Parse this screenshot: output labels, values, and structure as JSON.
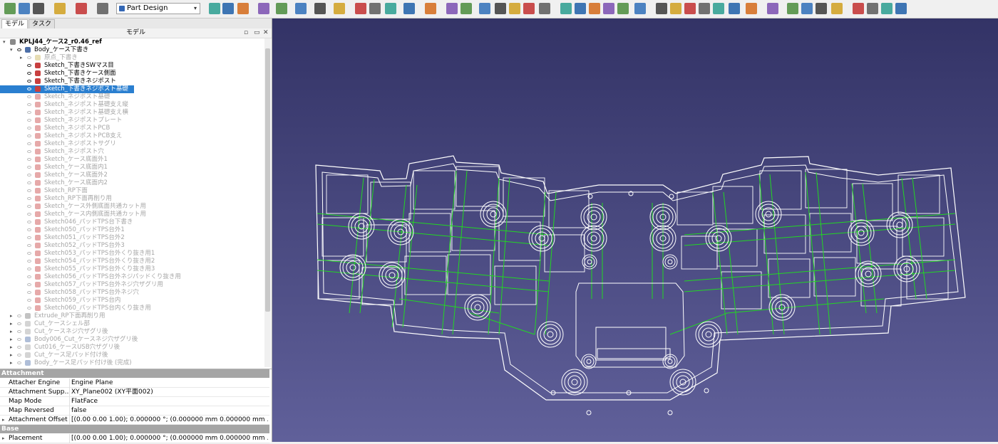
{
  "toolbar": {
    "workbench": "Part Design",
    "icons": [
      "new-file-icon",
      "open-file-icon",
      "save-icon",
      "undo-icon",
      "redo-icon",
      "refresh-icon",
      "zoom-fit-all-icon",
      "zoom-fit-selection-icon",
      "view-cube-icon",
      "measure-icon",
      "draw-style-icon",
      "std-views-icon",
      "zoom-icon",
      "view-menu-icon",
      "part-icon",
      "group-icon",
      "link-icon",
      "macro-icon",
      "whats-this-icon",
      "body-icon",
      "sketch-icon",
      "validate-sketch-icon",
      "attach-icon",
      "datum-point-icon",
      "datum-line-icon",
      "datum-plane-icon",
      "shapebinder-icon",
      "pad-icon",
      "revolve-icon",
      "loft-icon",
      "sweep-icon",
      "pocket-icon",
      "hole-icon",
      "groove-icon",
      "subtractive-loft-icon",
      "mirror-icon",
      "pattern-icon",
      "fillet-icon",
      "chamfer-icon",
      "draft-icon",
      "thickness-icon",
      "boolean-icon",
      "additive-primitives-icon",
      "subtractive-primitives-icon",
      "measure-linear-icon",
      "measure-angular-icon",
      "measure-refresh-icon",
      "measure-toggle-icon"
    ],
    "colors": {
      "toolbar_bg": "#f0f0f0"
    }
  },
  "panel": {
    "tabs": [
      "モデル",
      "タスク"
    ],
    "header": "モデル"
  },
  "tree": {
    "items": [
      {
        "label": "KPLJ44_ケース2_r0.46_ref",
        "state": "visible",
        "icon": "document-icon",
        "level": 0,
        "bold": true,
        "expander": "▾"
      },
      {
        "label": "Body_ケース下書き",
        "state": "visible",
        "icon": "body-icon",
        "level": 1,
        "expander": "▾"
      },
      {
        "label": "原点_下書き",
        "state": "hidden",
        "icon": "origin-icon",
        "level": 2,
        "expander": "▸"
      },
      {
        "label": "Sketch_下書きSWマス目",
        "state": "visible",
        "icon": "sketch-icon",
        "level": 2
      },
      {
        "label": "Sketch_下書きケース側面",
        "state": "visible",
        "icon": "sketch-icon",
        "level": 2
      },
      {
        "label": "Sketch_下書きネジポスト",
        "state": "visible",
        "icon": "sketch-icon",
        "level": 2
      },
      {
        "label": "Sketch_下書きネジポスト基礎",
        "state": "selected",
        "icon": "sketch-icon",
        "level": 2
      },
      {
        "label": "Sketch_ネジポスト基礎",
        "state": "hidden",
        "icon": "sketch-icon",
        "level": 2
      },
      {
        "label": "Sketch_ネジポスト基礎支え縦",
        "state": "hidden",
        "icon": "sketch-icon",
        "level": 2
      },
      {
        "label": "Sketch_ネジポスト基礎支え横",
        "state": "hidden",
        "icon": "sketch-icon",
        "level": 2
      },
      {
        "label": "Sketch_ネジポストプレート",
        "state": "hidden",
        "icon": "sketch-icon",
        "level": 2
      },
      {
        "label": "Sketch_ネジポストPCB",
        "state": "hidden",
        "icon": "sketch-icon",
        "level": 2
      },
      {
        "label": "Sketch_ネジポストPCB支え",
        "state": "hidden",
        "icon": "sketch-icon",
        "level": 2
      },
      {
        "label": "Sketch_ネジポストサグリ",
        "state": "hidden",
        "icon": "sketch-icon",
        "level": 2
      },
      {
        "label": "Sketch_ネジポスト穴",
        "state": "hidden",
        "icon": "sketch-icon",
        "level": 2
      },
      {
        "label": "Sketch_ケース底面外1",
        "state": "hidden",
        "icon": "sketch-icon",
        "level": 2
      },
      {
        "label": "Sketch_ケース底面内1",
        "state": "hidden",
        "icon": "sketch-icon",
        "level": 2
      },
      {
        "label": "Sketch_ケース底面外2",
        "state": "hidden",
        "icon": "sketch-icon",
        "level": 2
      },
      {
        "label": "Sketch_ケース底面内2",
        "state": "hidden",
        "icon": "sketch-icon",
        "level": 2
      },
      {
        "label": "Sketch_RP下面",
        "state": "hidden",
        "icon": "sketch-icon",
        "level": 2
      },
      {
        "label": "Sketch_RP下面再削り用",
        "state": "hidden",
        "icon": "sketch-icon",
        "level": 2
      },
      {
        "label": "Sketch_ケース外側底面共通カット用",
        "state": "hidden",
        "icon": "sketch-icon",
        "level": 2
      },
      {
        "label": "Sketch_ケース内側底面共通カット用",
        "state": "hidden",
        "icon": "sketch-icon",
        "level": 2
      },
      {
        "label": "Sketch046_パッドTPS台下書き",
        "state": "hidden",
        "icon": "sketch-icon",
        "level": 2
      },
      {
        "label": "Sketch050_パッドTPS台外1",
        "state": "hidden",
        "icon": "sketch-icon",
        "level": 2
      },
      {
        "label": "Sketch051_パッドTPS台外2",
        "state": "hidden",
        "icon": "sketch-icon",
        "level": 2
      },
      {
        "label": "Sketch052_パッドTPS台外3",
        "state": "hidden",
        "icon": "sketch-icon",
        "level": 2
      },
      {
        "label": "Sketch053_パッドTPS台外くり抜き用1",
        "state": "hidden",
        "icon": "sketch-icon",
        "level": 2
      },
      {
        "label": "Sketch054_パッドTPS台外くり抜き用2",
        "state": "hidden",
        "icon": "sketch-icon",
        "level": 2
      },
      {
        "label": "Sketch055_パッドTPS台外くり抜き用3",
        "state": "hidden",
        "icon": "sketch-icon",
        "level": 2
      },
      {
        "label": "Sketch056_パッドTPS台外ネジパッドくり抜き用",
        "state": "hidden",
        "icon": "sketch-icon",
        "level": 2
      },
      {
        "label": "Sketch057_パッドTPS台外ネジ穴ザグリ用",
        "state": "hidden",
        "icon": "sketch-icon",
        "level": 2
      },
      {
        "label": "Sketch058_パッドTPS台外ネジ穴",
        "state": "hidden",
        "icon": "sketch-icon",
        "level": 2
      },
      {
        "label": "Sketch059_パッドTPS台内",
        "state": "hidden",
        "icon": "sketch-icon",
        "level": 2
      },
      {
        "label": "Sketch060_パッドTPS台内くり抜き用",
        "state": "hidden",
        "icon": "sketch-icon",
        "level": 2
      },
      {
        "label": "Extrude_RP下面再削り用",
        "state": "hidden",
        "icon": "extrude-icon",
        "level": 1,
        "expander": "▸"
      },
      {
        "label": "Cut_ケースシェル部",
        "state": "hidden",
        "icon": "cut-icon",
        "level": 1,
        "expander": "▸"
      },
      {
        "label": "Cut_ケースネジ穴ザグリ後",
        "state": "hidden",
        "icon": "cut-icon",
        "level": 1,
        "expander": "▸"
      },
      {
        "label": "Body006_Cut_ケースネジ穴ザグリ後",
        "state": "hidden",
        "icon": "body-icon",
        "level": 1,
        "expander": "▸"
      },
      {
        "label": "Cut016_ケースUSB穴ザグリ後",
        "state": "hidden",
        "icon": "cut-icon",
        "level": 1,
        "expander": "▸"
      },
      {
        "label": "Cut_ケース足パッド付け後",
        "state": "hidden",
        "icon": "cut-icon",
        "level": 1,
        "expander": "▸"
      },
      {
        "label": "Body_ケース足パッド付け後 (完成)",
        "state": "hidden",
        "icon": "body-icon",
        "level": 1,
        "expander": "▸"
      }
    ]
  },
  "properties": {
    "groups": [
      {
        "name": "Attachment",
        "rows": [
          {
            "key": "Attacher Engine",
            "value": "Engine Plane"
          },
          {
            "key": "Attachment Supp…",
            "value": "XY_Plane002 (XY平面002)"
          },
          {
            "key": "Map Mode",
            "value": "FlatFace"
          },
          {
            "key": "Map Reversed",
            "value": "false"
          },
          {
            "key": "Attachment Offset",
            "value": "[(0.00 0.00 1.00); 0.000000 °; (0.000000 mm  0.000000 mm …",
            "expandable": true
          }
        ]
      },
      {
        "name": "Base",
        "rows": [
          {
            "key": "Placement",
            "value": "[(0.00 0.00 1.00); 0.000000 °; (0.000000 mm  0.000000 mm …",
            "expandable": true
          }
        ]
      }
    ]
  },
  "viewport": {
    "colors": {
      "bg_top": "#333366",
      "bg_bottom": "#60609a",
      "outline": "#ffffff",
      "guide": "#22d822"
    }
  }
}
